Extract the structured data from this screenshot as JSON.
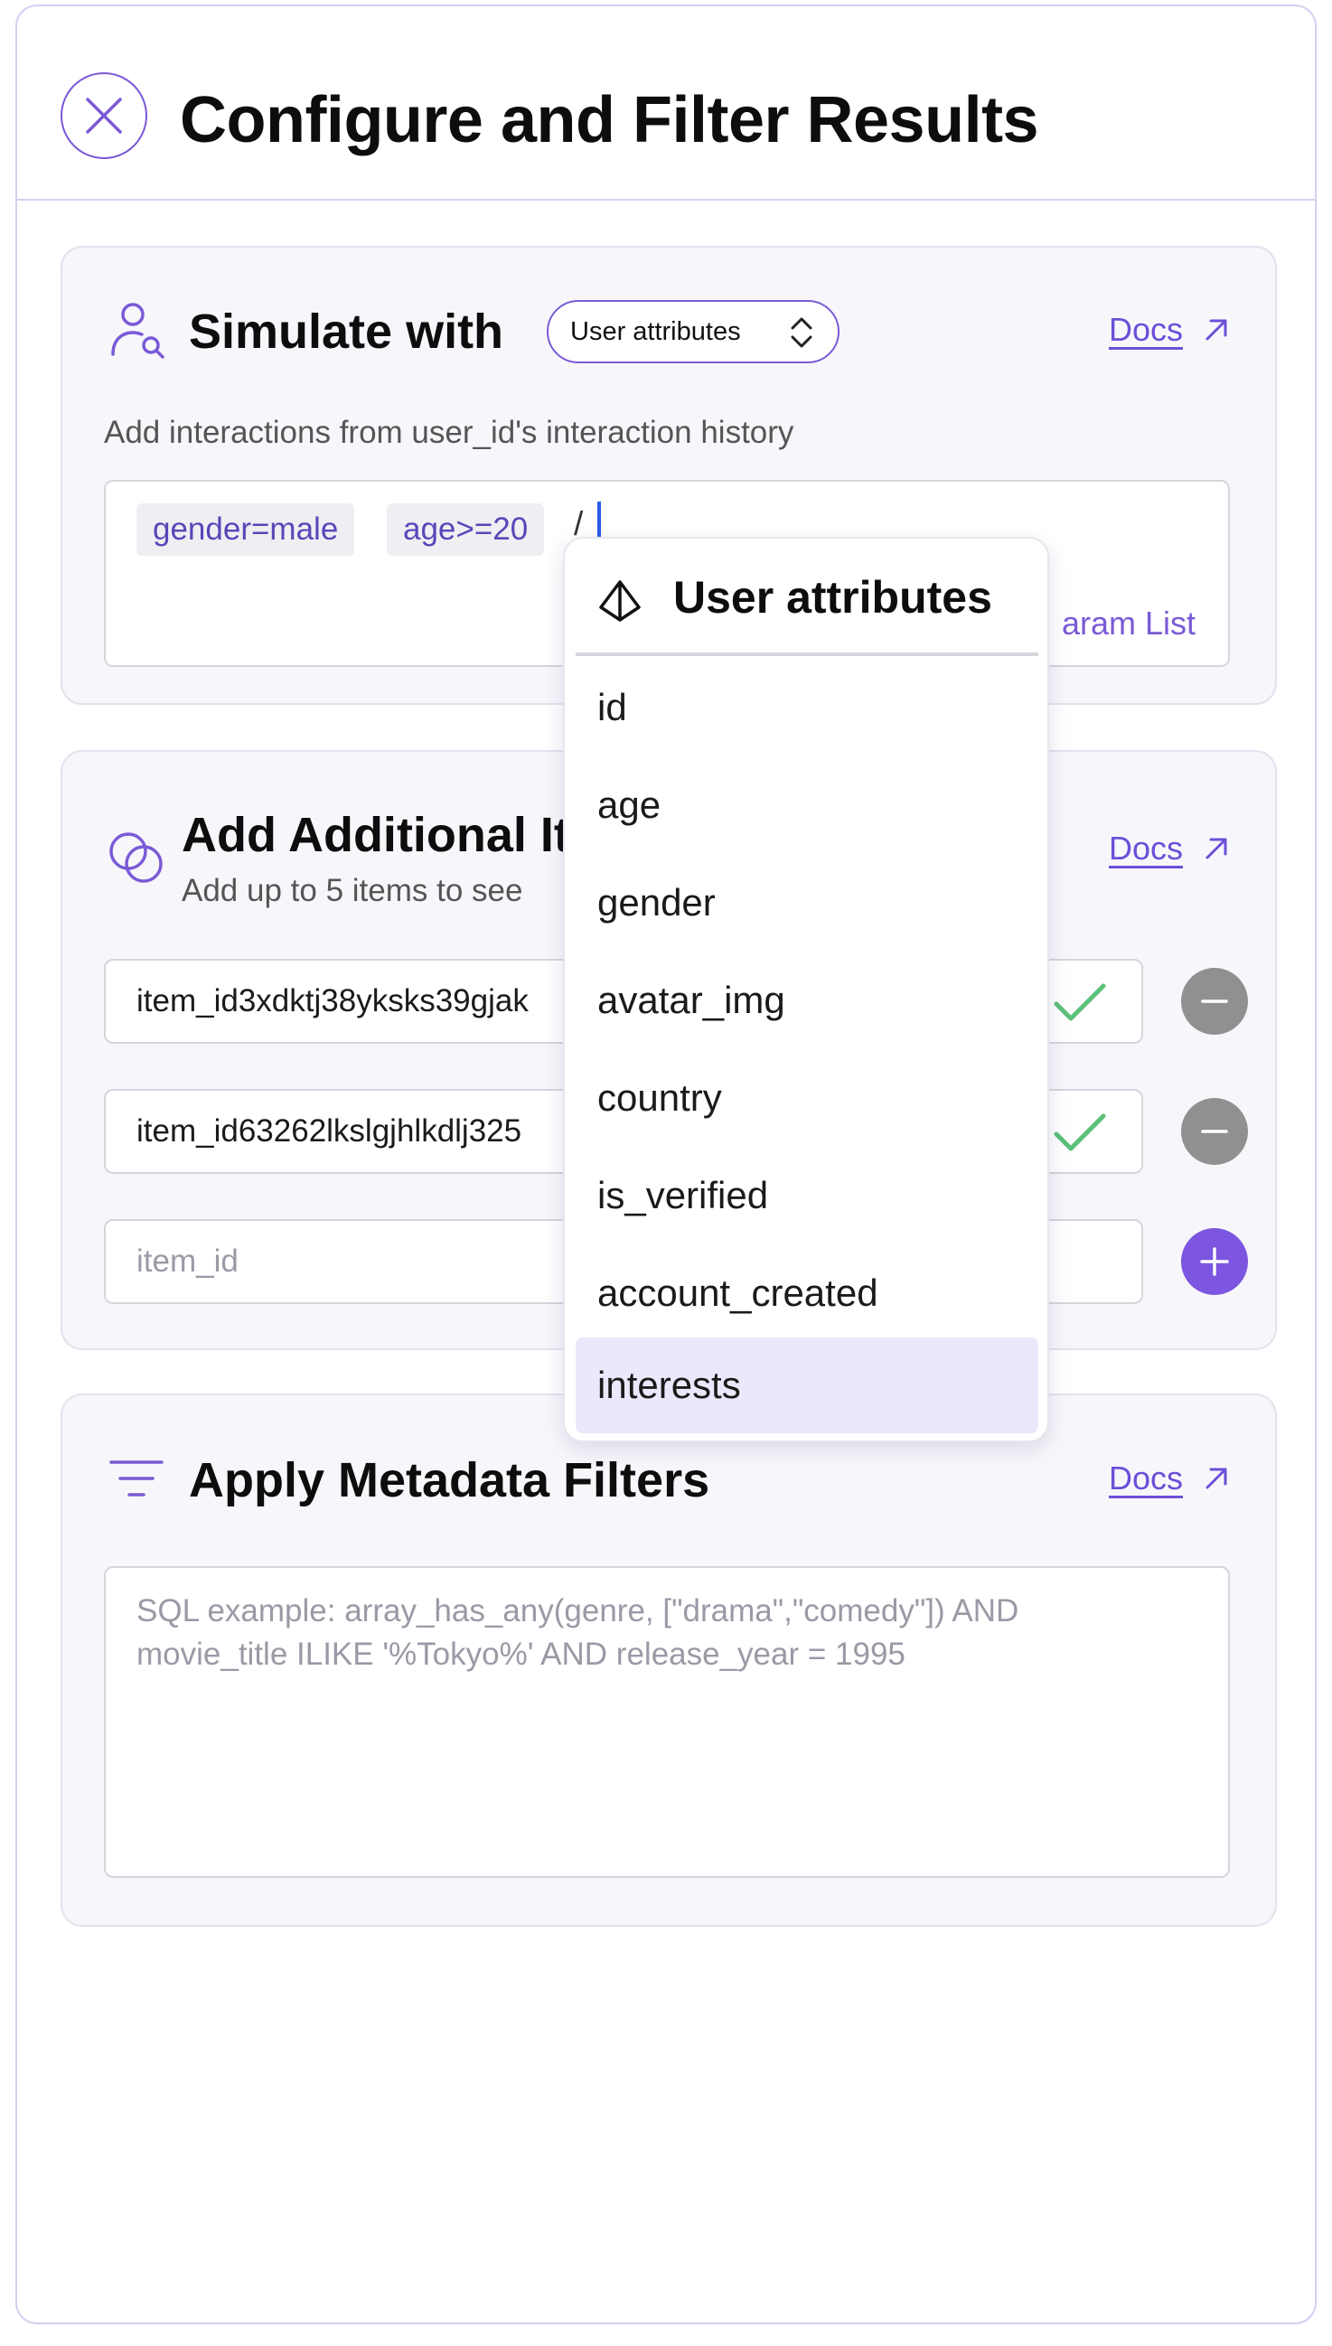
{
  "header": {
    "title": "Configure and Filter Results"
  },
  "simulate": {
    "title": "Simulate with",
    "select_value": "User attributes",
    "docs_label": "Docs",
    "description": "Add interactions from user_id's interaction history",
    "tokens": [
      "gender=male",
      "age>=20"
    ],
    "slash": "/",
    "param_list_label": "aram List"
  },
  "items": {
    "title": "Add Additional It",
    "subtitle": "Add up to 5 items to see",
    "docs_label": "Docs",
    "rows": [
      {
        "value": "item_id3xdktj38yksks39gjak"
      },
      {
        "value": "item_id63262lkslgjhlkdlj325"
      }
    ],
    "new_placeholder": "item_id"
  },
  "filters": {
    "title": "Apply Metadata Filters",
    "docs_label": "Docs",
    "placeholder_line1": "SQL example: array_has_any(genre, [\"drama\",\"comedy\"]) AND",
    "placeholder_line2": "movie_title ILIKE '%Tokyo%' AND release_year = 1995"
  },
  "dropdown": {
    "title": "User attributes",
    "options": [
      "id",
      "age",
      "gender",
      "avatar_img",
      "country",
      "is_verified",
      "account_created",
      "interests"
    ],
    "highlighted": "interests"
  },
  "colors": {
    "accent": "#7a5ad6",
    "link": "#6c4fd8",
    "check": "#5cc07a",
    "minus_button": "#909090",
    "plus_button": "#7c55e0",
    "highlight": "#ebe8fb"
  },
  "icons": {
    "close": "close-icon",
    "user_search": "user-search-icon",
    "select_chevrons": "chevron-up-down-icon",
    "external": "arrow-up-right-icon",
    "overlap_circles": "overlap-circles-icon",
    "check": "check-icon",
    "minus": "minus-icon",
    "plus": "plus-icon",
    "filter": "filter-icon",
    "attribute": "pyramid-icon"
  }
}
